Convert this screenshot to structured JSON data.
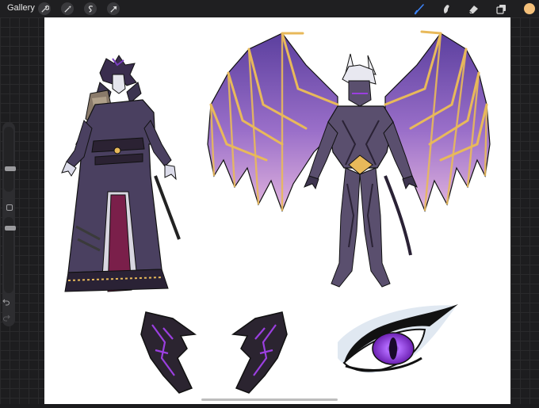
{
  "app": {
    "gallery_label": "Gallery"
  },
  "toolbar": {
    "left_tools": [
      "wrench-icon",
      "magic-wand-icon",
      "selection-icon",
      "transform-arrow-icon"
    ],
    "right_tools": [
      "brush-icon",
      "smudge-icon",
      "eraser-icon",
      "layers-icon"
    ],
    "active_tool": "brush-icon",
    "accent_color": "#3b82f6",
    "current_color": "#f4c07a"
  },
  "sidebar": {
    "brush_size": 0.62,
    "brush_opacity": 0.57
  },
  "canvas": {
    "background": "#ffffff",
    "artwork_colors": {
      "wing_purple": "#7b5bb5",
      "wing_pink": "#c79ad8",
      "gold": "#e8b95a",
      "armor_dark": "#5a4f6e",
      "robe": "#4a4060",
      "robe_red": "#7a1f4a",
      "eye_purple": "#9b3fe0"
    }
  }
}
